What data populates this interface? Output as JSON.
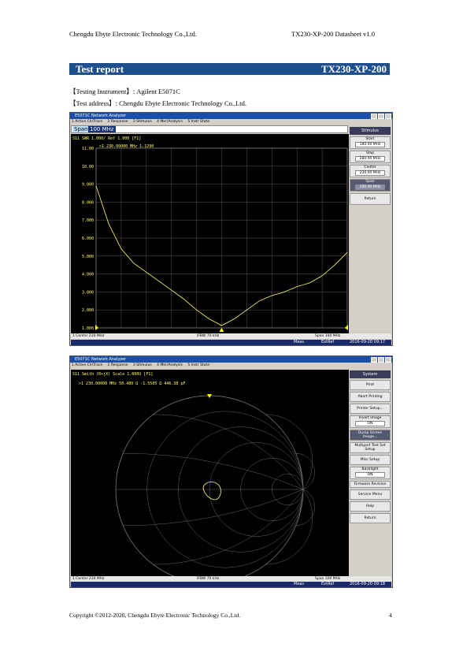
{
  "header": {
    "company": "Chengdu Ebyte Electronic Technology Co.,Ltd.",
    "doc": "TX230-XP-200 Datasheet v1.0"
  },
  "section": {
    "title": "Test report",
    "model": "TX230-XP-200"
  },
  "info": {
    "instrument": "【Testing Instrument】:  Agilent E5071C",
    "address": "【Test address】:  Chengdu Ebyte Electronic Technology Co.,Ltd."
  },
  "win1": {
    "title": "E5071C Network Analyzer",
    "menu": [
      "1 Active Ch/Trace",
      "2 Response",
      "3 Stimulus",
      "4 Mkr/Analysis",
      "5 Instr State"
    ],
    "entry_label": "Span",
    "entry_value": "100 MHz",
    "trace_label": "S11 SWR 1.000/ Ref 1.000 [F1]",
    "marker": ">1  230.00000 MHz  1.1290",
    "yticks": [
      "11.00",
      "10.00",
      "9.000",
      "8.000",
      "7.000",
      "6.000",
      "5.000",
      "4.000",
      "3.000",
      "2.000",
      "1.000"
    ],
    "status_left": "1  Center 230 MHz",
    "status_mid": "IFBW 70 kHz",
    "status_right": "Span 100 MHz",
    "meas": "Meas",
    "extref": "ExtRef",
    "datetime": "2016-09-20 09:17",
    "side_title": "Stimulus",
    "side": [
      {
        "label": "Start",
        "value": "180.00 MHz"
      },
      {
        "label": "Stop",
        "value": "280.00 MHz"
      },
      {
        "label": "Center",
        "value": "230.00 MHz"
      },
      {
        "label": "Span",
        "value": "100.00 MHz"
      },
      {
        "label": "Return",
        "value": ""
      }
    ]
  },
  "win2": {
    "title": "E5071C Network Analyzer",
    "menu": [
      "1 Active Ch/Trace",
      "2 Response",
      "3 Stimulus",
      "4 Mkr/Analysis",
      "5 Instr State"
    ],
    "trace_label": "S11 Smith (R+jX) Scale 1.000U [F1]",
    "marker": ">1  230.00000 MHz  50.480 Ω -1.5505 Ω  446.38 pF",
    "status_left": "1  Center 230 MHz",
    "status_mid": "IFBW 70 kHz",
    "status_right": "Span 100 MHz",
    "meas": "Meas",
    "extref": "ExtRef",
    "datetime": "2016-09-20 09:18",
    "side_title": "System",
    "side": [
      {
        "label": "Print",
        "value": ""
      },
      {
        "label": "Abort Printing",
        "value": ""
      },
      {
        "label": "Printer Setup...",
        "value": ""
      },
      {
        "label": "Invert Image",
        "value": "ON"
      },
      {
        "label": "Dump Screen Image...",
        "value": ""
      },
      {
        "label": "Multiport Test Set Setup",
        "value": ""
      },
      {
        "label": "Misc Setup",
        "value": ""
      },
      {
        "label": "Backlight",
        "value": "ON"
      },
      {
        "label": "Firmware Revision",
        "value": ""
      },
      {
        "label": "Service Menu",
        "value": ""
      },
      {
        "label": "Help",
        "value": ""
      },
      {
        "label": "Return",
        "value": ""
      }
    ]
  },
  "footer": {
    "copyright": "Copyright ©2012-2020,  Chengdu Ebyte Electronic Technology Co.,Ltd.",
    "page": "4"
  },
  "chart_data": {
    "type": "line",
    "x_range_mhz": [
      180,
      280
    ],
    "ylim": [
      1,
      11
    ],
    "series": [
      {
        "x": [
          180,
          185,
          190,
          195,
          200,
          205,
          210,
          215,
          220,
          225,
          230,
          235,
          240,
          245,
          250,
          255,
          260,
          265,
          270,
          275,
          280
        ],
        "values": [
          8.9,
          6.8,
          5.4,
          4.6,
          4.1,
          3.6,
          3.1,
          2.6,
          2.0,
          1.5,
          1.13,
          1.5,
          2.0,
          2.5,
          2.8,
          3.0,
          3.3,
          3.5,
          3.9,
          4.5,
          5.2
        ]
      }
    ]
  }
}
